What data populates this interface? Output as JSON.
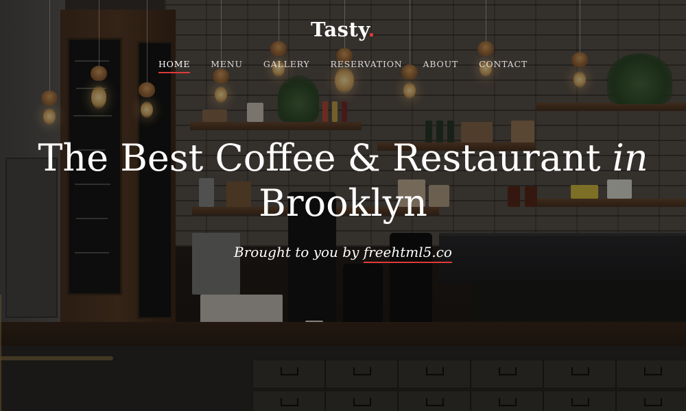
{
  "brand": {
    "name": "Tasty",
    "dot": ".",
    "accent_color": "#e03a3a"
  },
  "nav": {
    "items": [
      {
        "label": "HOME",
        "active": true
      },
      {
        "label": "MENU",
        "active": false
      },
      {
        "label": "GALLERY",
        "active": false
      },
      {
        "label": "RESERVATION",
        "active": false
      },
      {
        "label": "ABOUT",
        "active": false
      },
      {
        "label": "CONTACT",
        "active": false
      }
    ]
  },
  "hero": {
    "headline_main": "The Best Coffee & Restaurant",
    "headline_italic": "in",
    "headline_second_line": "Brooklyn",
    "byline_prefix": "Brought to you by",
    "byline_link": "freehtml5.co",
    "background_image": "coffee-shop-interior"
  }
}
